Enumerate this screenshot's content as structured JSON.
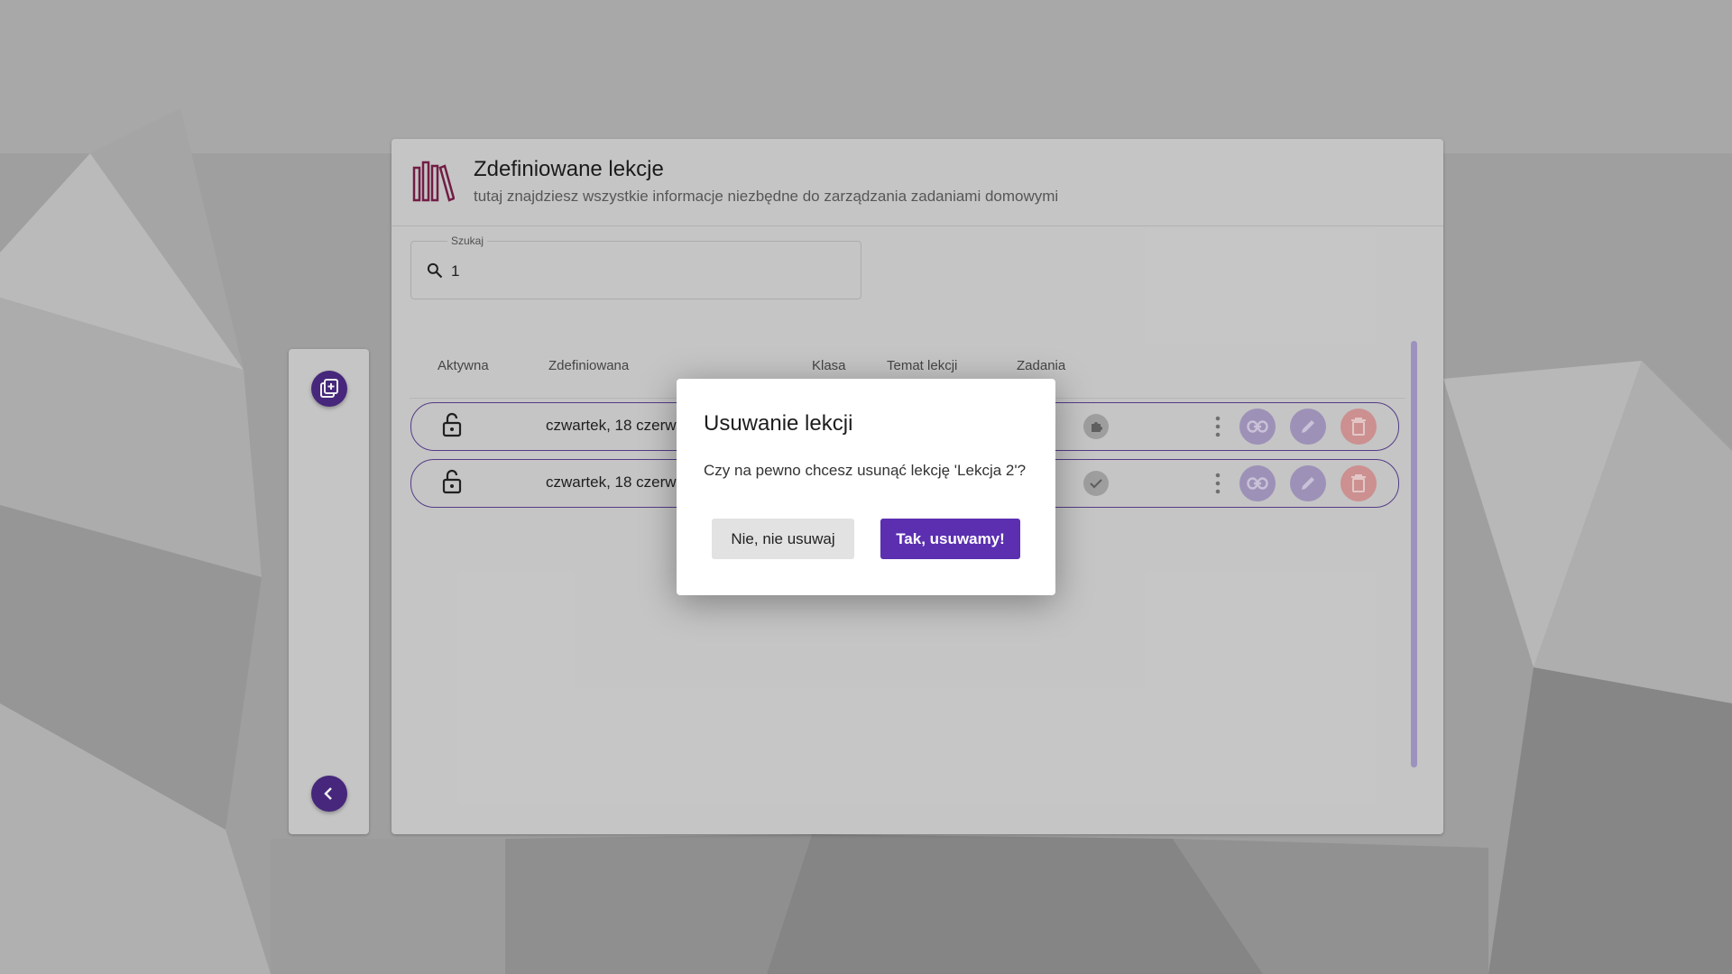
{
  "header": {
    "title": "Zdefiniowane lekcje",
    "subtitle": "tutaj znajdziesz wszystkie informacje niezbędne do zarządzania zadaniami domowymi"
  },
  "search": {
    "label": "Szukaj",
    "value": "1"
  },
  "table": {
    "columns": [
      "Aktywna",
      "Zdefiniowana",
      "Klasa",
      "Temat lekcji",
      "Zadania"
    ],
    "rows": [
      {
        "date": "czwartek, 18 czerw"
      },
      {
        "date": "czwartek, 18 czerw"
      }
    ]
  },
  "dialog": {
    "title": "Usuwanie lekcji",
    "message": "Czy na pewno chcesz usunąć lekcję 'Lekcja 2'?",
    "cancel_label": "Nie, nie usuwaj",
    "confirm_label": "Tak, usuwamy!"
  },
  "colors": {
    "accent": "#5b2fb0",
    "fab": "#4b2a83",
    "row_border": "#5a3f8f",
    "delete": "#d99a9a",
    "icon_maroon": "#7a1f4a"
  },
  "icons": [
    "books-icon",
    "search-icon",
    "add-lesson-icon",
    "back-icon",
    "lock-open-icon",
    "puzzle-icon",
    "check-icon",
    "more-vert-icon",
    "link-icon",
    "edit-icon",
    "delete-icon"
  ]
}
